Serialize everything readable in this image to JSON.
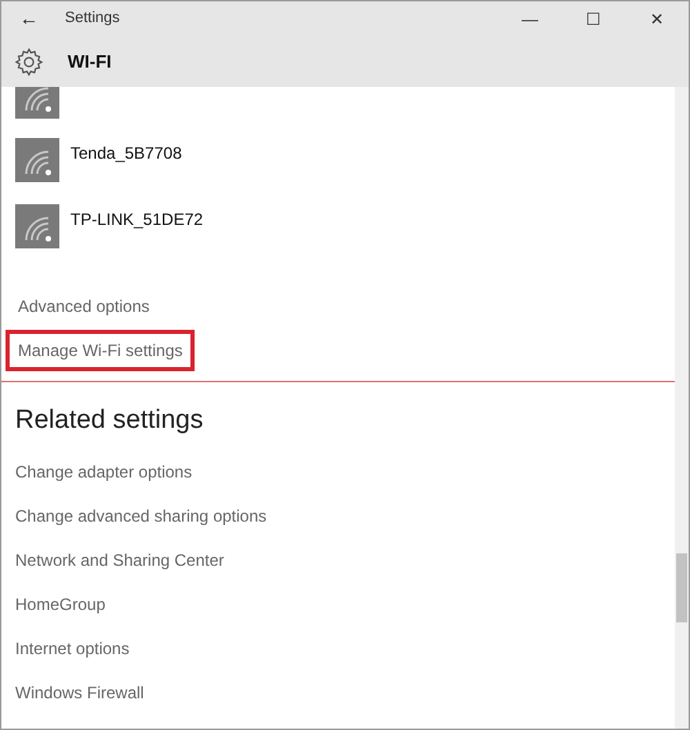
{
  "window": {
    "title": "Settings",
    "back": "←",
    "controls": [
      "—",
      "☐",
      "✕"
    ]
  },
  "header": {
    "title": "WI-FI"
  },
  "networks": [
    {
      "partial": true
    },
    {
      "name": "Tenda_5B7708"
    },
    {
      "name": "TP-LINK_51DE72"
    }
  ],
  "links": [
    {
      "label": "Advanced options",
      "highlighted": false
    },
    {
      "label": "Manage Wi-Fi settings",
      "highlighted": true
    }
  ],
  "related": {
    "title": "Related settings",
    "links": [
      "Change adapter options",
      "Change advanced sharing options",
      "Network and Sharing Center",
      "HomeGroup",
      "Internet options",
      "Windows Firewall"
    ]
  }
}
